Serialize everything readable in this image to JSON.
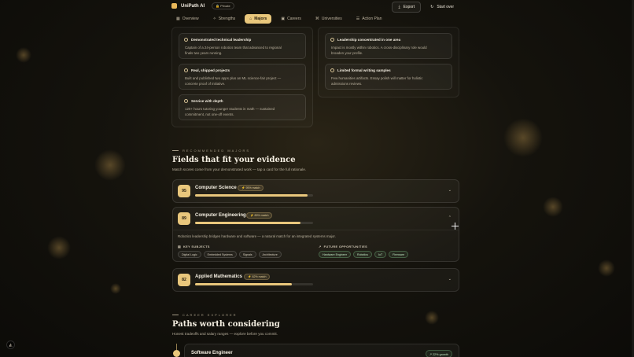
{
  "app": {
    "name": "UniPath AI",
    "privacy_badge": "Private"
  },
  "toolbar": {
    "export_label": "Export",
    "start_over_label": "Start over"
  },
  "tabs": [
    {
      "label": "Overview",
      "active": false
    },
    {
      "label": "Strengths",
      "active": false
    },
    {
      "label": "Majors",
      "active": true
    },
    {
      "label": "Careers",
      "active": false
    },
    {
      "label": "Universities",
      "active": false
    },
    {
      "label": "Action Plan",
      "active": false
    }
  ],
  "strengths": [
    {
      "title": "Demonstrated technical leadership",
      "body_l1": "Captain of a 24-person robotics team that advanced to regional",
      "body_l2": "finals two years running."
    },
    {
      "title": "Real, shipped projects",
      "body_l1": "Built and published two apps plus an ML science-fair project —",
      "body_l2": "concrete proof of initiative."
    },
    {
      "title": "Service with depth",
      "body_l1": "120+ hours tutoring younger students in math — sustained",
      "body_l2": "commitment, not one-off events."
    }
  ],
  "gaps": [
    {
      "title": "Leadership concentrated in one area",
      "body_l1": "Impact is mostly within robotics. A cross-disciplinary role would",
      "body_l2": "broaden your profile."
    },
    {
      "title": "Limited formal writing samples",
      "body_l1": "Few humanities artifacts. Essay polish will matter for holistic",
      "body_l2": "admissions reviews."
    }
  ],
  "majors_section": {
    "eyebrow": "RECOMMENDED MAJORS",
    "title": "Fields that fit your evidence",
    "subtitle": "Match scores come from your demonstrated work — tap a card for the full rationale."
  },
  "majors": [
    {
      "score": "95",
      "name": "Computer Science",
      "match": "95% match",
      "fraction": 0.95
    },
    {
      "score": "89",
      "name": "Computer Engineering",
      "match": "89% match",
      "fraction": 0.89,
      "reason": "Robotics leadership bridges hardware and software — a natural match for an integrated systems major.",
      "key_subjects_label": "KEY SUBJECTS",
      "key_subjects": [
        "Digital Logic",
        "Embedded Systems",
        "Signals",
        "Architecture"
      ],
      "future_label": "FUTURE OPPORTUNITIES",
      "future": [
        "Hardware Engineer",
        "Robotics",
        "IoT",
        "Firmware"
      ]
    },
    {
      "score": "82",
      "name": "Applied Mathematics",
      "match": "82% match",
      "fraction": 0.82
    }
  ],
  "careers_section": {
    "eyebrow": "CAREER EXPLORER",
    "title": "Paths worth considering",
    "subtitle": "Honest tradeoffs and salary ranges — explore before you commit."
  },
  "careers": [
    {
      "name": "Software Engineer",
      "growth": "22% growth"
    }
  ],
  "colors": {
    "accent": "#e9c77c",
    "background": "#15130d",
    "growth": "#bfe3c0"
  }
}
